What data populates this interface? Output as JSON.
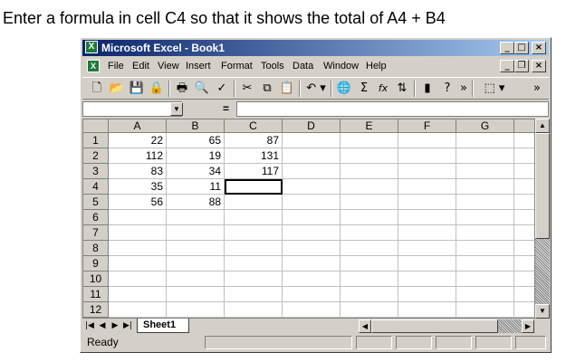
{
  "instruction": "Enter a formula in cell C4 so that it shows the total of A4 + B4",
  "window": {
    "title": "Microsoft Excel - Book1",
    "controls": [
      "minimize",
      "maximize",
      "close"
    ]
  },
  "menu": [
    {
      "label": "File",
      "icon": "excel-doc-icon"
    },
    {
      "label": "Edit"
    },
    {
      "label": "View"
    },
    {
      "label": "Insert"
    },
    {
      "label": "Format"
    },
    {
      "label": "Tools"
    },
    {
      "label": "Data"
    },
    {
      "label": "Window"
    },
    {
      "label": "Help"
    }
  ],
  "toolbar": {
    "buttons": [
      "new-icon",
      "open-icon",
      "save-icon",
      "permission-icon",
      "print-icon",
      "print-preview-icon",
      "spelling-icon",
      "cut-icon",
      "copy-icon",
      "paste-icon",
      "undo-icon",
      "hyperlink-icon",
      "autosum-icon",
      "function-icon",
      "sort-ascending-icon",
      "chart-wizard-icon",
      "help-icon",
      "more-icon",
      "borders-icon",
      "more-icon"
    ],
    "glyphs": {
      "autosum": "Σ",
      "function": "fx"
    }
  },
  "formula_bar": {
    "name_box_value": "",
    "equals_label": "=",
    "formula_value": ""
  },
  "sheet": {
    "columns": [
      "A",
      "B",
      "C",
      "D",
      "E",
      "F",
      "G"
    ],
    "rows": [
      "1",
      "2",
      "3",
      "4",
      "5",
      "6",
      "7",
      "8",
      "9",
      "10",
      "11",
      "12"
    ],
    "cells": {
      "A1": "22",
      "B1": "65",
      "C1": "87",
      "A2": "112",
      "B2": "19",
      "C2": "131",
      "A3": "83",
      "B3": "34",
      "C3": "117",
      "A4": "35",
      "B4": "11",
      "C4": "",
      "A5": "56",
      "B5": "88"
    },
    "active_cell": "C4"
  },
  "tabs": {
    "sheet_name": "Sheet1"
  },
  "status": {
    "text": "Ready"
  }
}
